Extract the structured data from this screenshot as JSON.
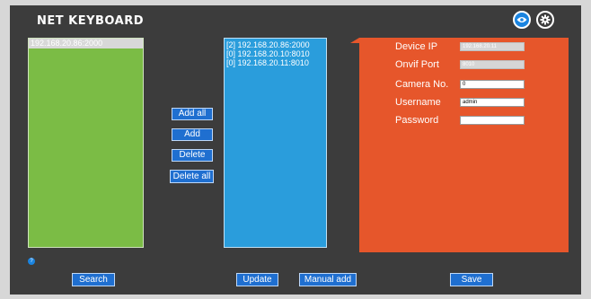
{
  "header": {
    "title": "NET KEYBOARD",
    "icons": [
      "eye-icon",
      "gear-icon"
    ]
  },
  "discovered_list": {
    "items": [
      "192.168.20.86:2000"
    ]
  },
  "actions": {
    "add_all": "Add all",
    "add": "Add",
    "delete": "Delete",
    "delete_all": "Delete all"
  },
  "device_list": {
    "items": [
      "[2] 192.168.20.86:2000",
      "[0] 192.168.20.10:8010",
      "[0] 192.168.20.11:8010"
    ]
  },
  "device_form": {
    "device_ip_label": "Device IP",
    "device_ip_value": "192.168.20.11",
    "onvif_port_label": "Onvif Port",
    "onvif_port_value": "8010",
    "camera_no_label": "Camera No.",
    "camera_no_value": "0",
    "username_label": "Username",
    "username_value": "admin",
    "password_label": "Password",
    "password_value": ""
  },
  "help": {
    "glyph": "?"
  },
  "bottom": {
    "search": "Search",
    "update": "Update",
    "manual_add": "Manual add",
    "save": "Save"
  },
  "colors": {
    "background": "#3c3c3c",
    "discovered_panel": "#7bbc45",
    "device_panel": "#2a9ddc",
    "form_panel": "#e6562b",
    "button": "#1f6fd0"
  }
}
